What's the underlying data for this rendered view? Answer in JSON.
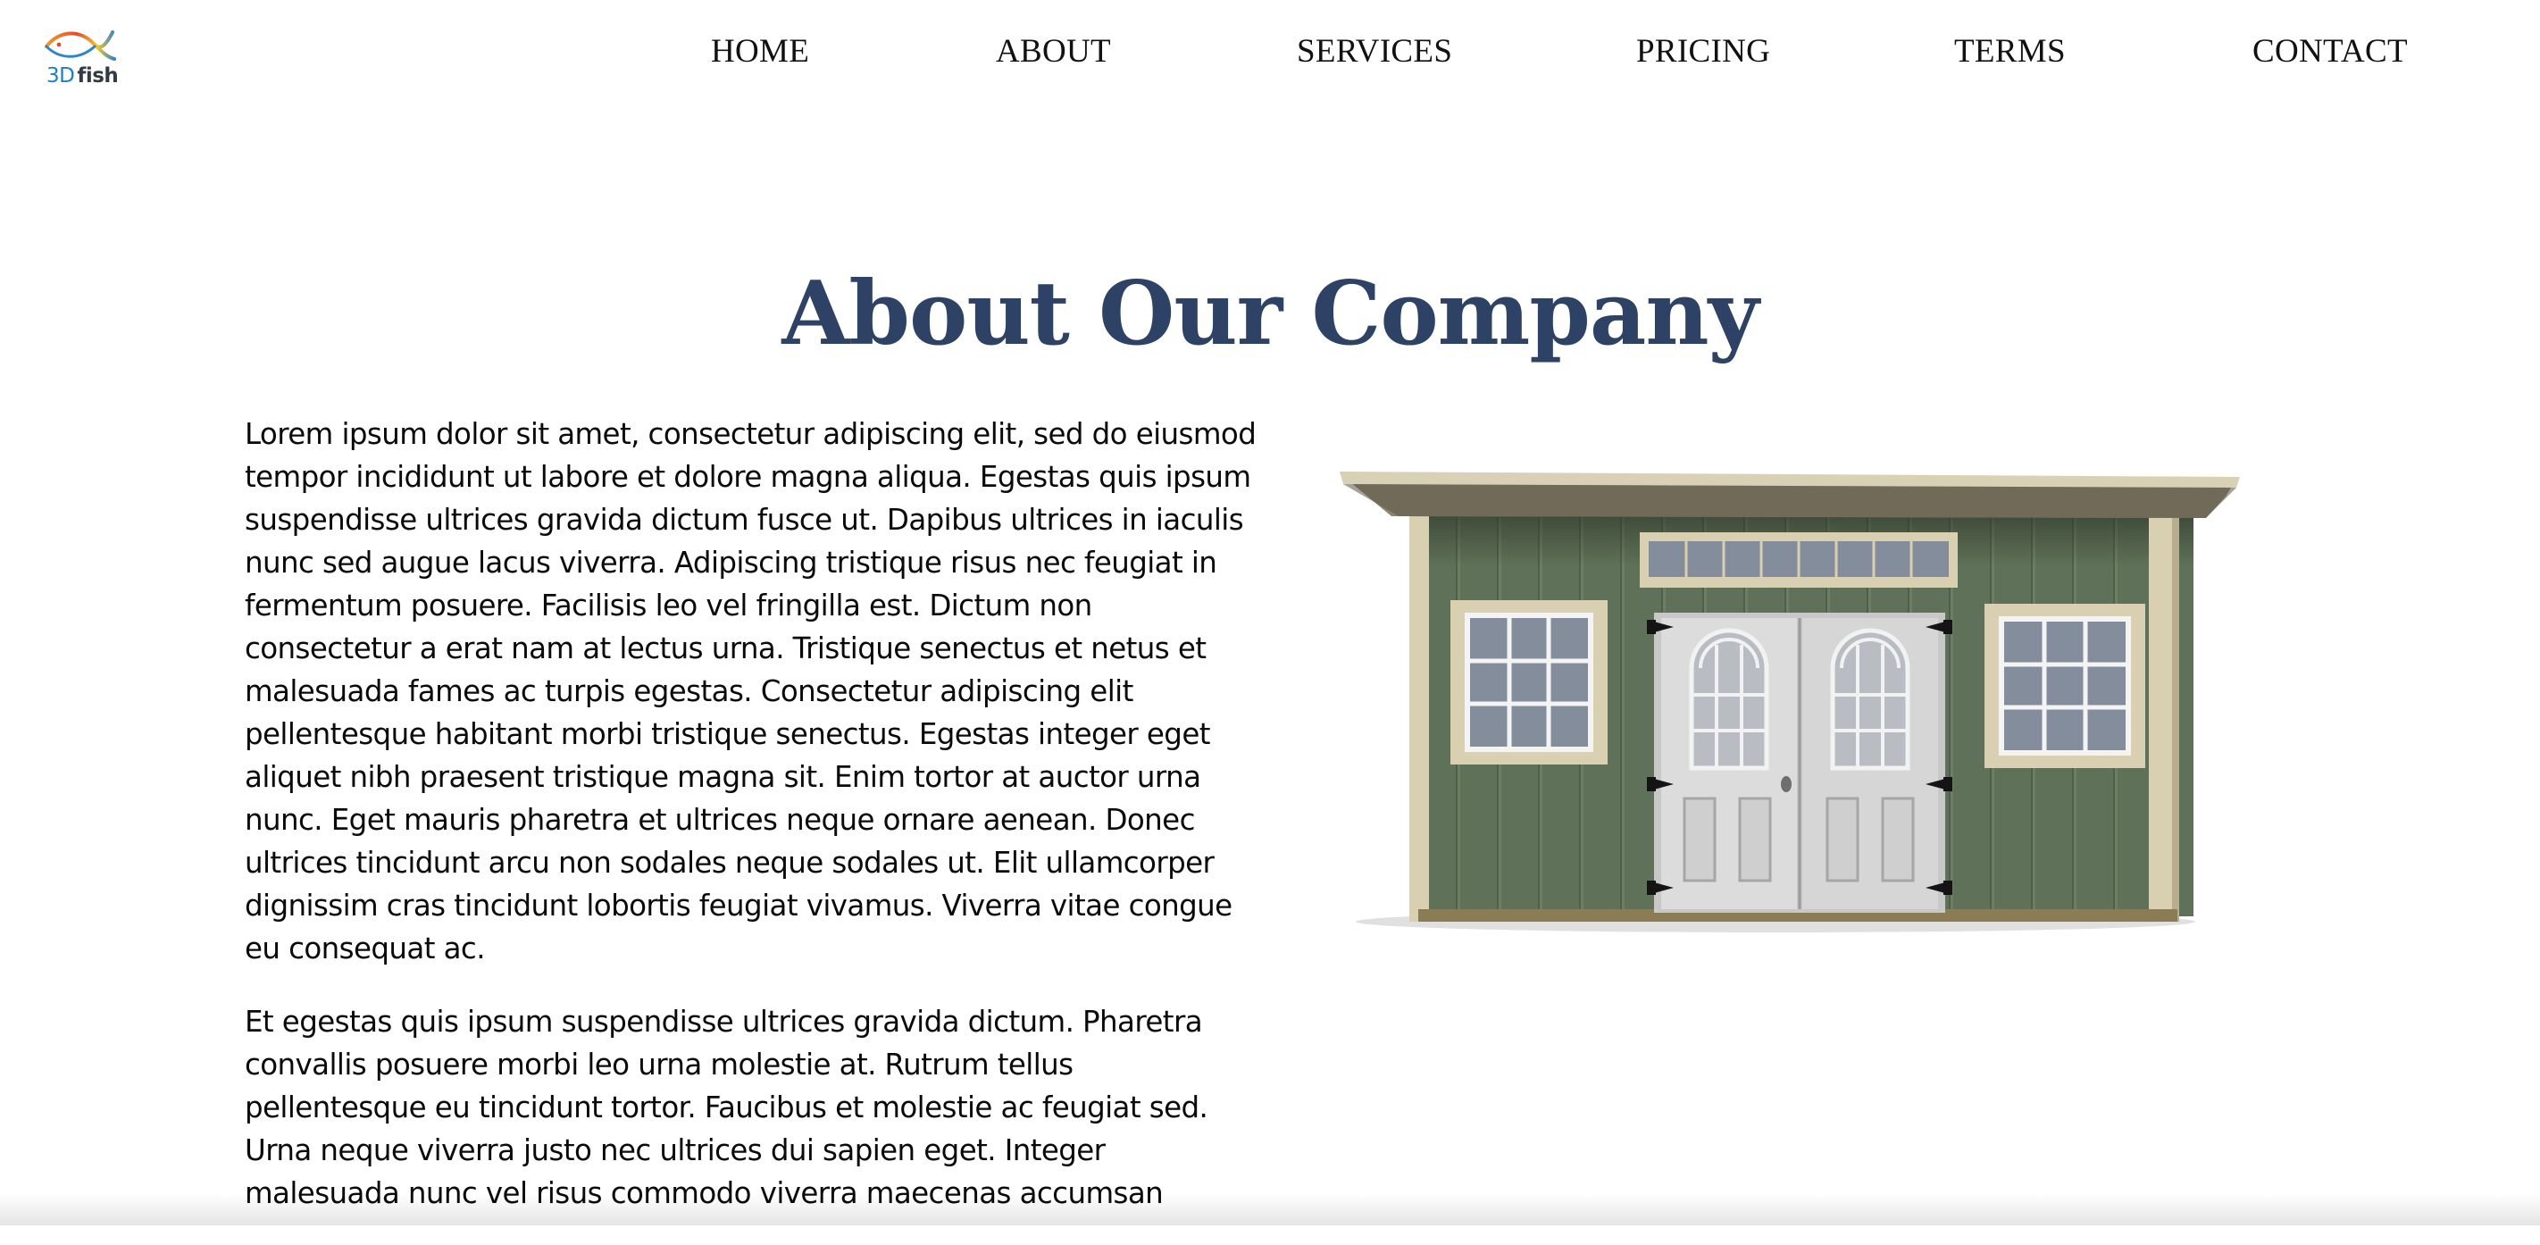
{
  "logo": {
    "text_3d": "3D",
    "text_fish": "fish",
    "icon": "fish-logo-icon"
  },
  "nav": {
    "items": [
      {
        "label": "HOME"
      },
      {
        "label": "ABOUT"
      },
      {
        "label": "SERVICES"
      },
      {
        "label": "PRICING"
      },
      {
        "label": "TERMS"
      },
      {
        "label": "CONTACT"
      }
    ]
  },
  "main": {
    "title": "About Our Company",
    "paragraphs": [
      "Lorem ipsum dolor sit amet, consectetur adipiscing elit, sed do eiusmod tempor incididunt ut labore et dolore magna aliqua. Egestas quis ipsum suspendisse ultrices gravida dictum fusce ut. Dapibus ultrices in iaculis nunc sed augue lacus viverra. Adipiscing tristique risus nec feugiat in fermentum posuere. Facilisis leo vel fringilla est. Dictum non consectetur a erat nam at lectus urna. Tristique senectus et netus et malesuada fames ac turpis egestas. Consectetur adipiscing elit pellentesque habitant morbi tristique senectus. Egestas integer eget aliquet nibh praesent tristique magna sit. Enim tortor at auctor urna nunc. Eget mauris pharetra et ultrices neque ornare aenean. Donec ultrices tincidunt arcu non sodales neque sodales ut. Elit ullamcorper dignissim cras tincidunt lobortis feugiat vivamus. Viverra vitae congue eu consequat ac.",
      "Et egestas quis ipsum suspendisse ultrices gravida dictum. Pharetra convallis posuere morbi leo urna molestie at. Rutrum tellus pellentesque eu tincidunt tortor. Faucibus et molestie ac feugiat sed. Urna neque viverra justo nec ultrices dui sapien eget. Integer malesuada nunc vel risus commodo viverra maecenas accumsan"
    ],
    "image": "shed-illustration"
  },
  "colors": {
    "title": "#2e4266",
    "shed_wall": "#5f7158",
    "shed_trim": "#d9cfb1",
    "door": "#d6d6d6"
  }
}
